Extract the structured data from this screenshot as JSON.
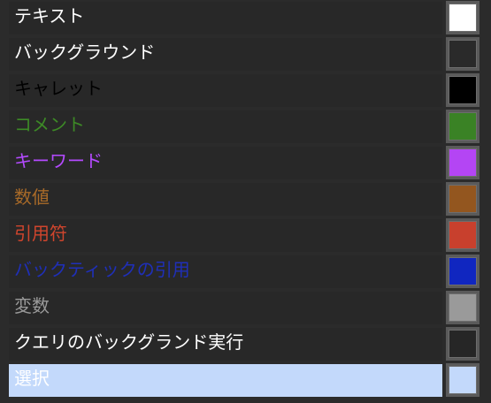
{
  "color_settings": [
    {
      "label": "テキスト",
      "text_color": "#ffffff",
      "swatch": "#ffffff"
    },
    {
      "label": "バックグラウンド",
      "text_color": "#ffffff",
      "swatch": "#2a2a2a"
    },
    {
      "label": "キャレット",
      "text_color": "#000000",
      "swatch": "#000000"
    },
    {
      "label": "コメント",
      "text_color": "#3d8a26",
      "swatch": "#3a8225"
    },
    {
      "label": "キーワード",
      "text_color": "#b44aff",
      "swatch": "#b445f4"
    },
    {
      "label": "数値",
      "text_color": "#a86a28",
      "swatch": "#93561f"
    },
    {
      "label": "引用符",
      "text_color": "#d0452d",
      "swatch": "#c8402d"
    },
    {
      "label": "バックティックの引用",
      "text_color": "#1f2fb8",
      "swatch": "#1026c0"
    },
    {
      "label": "変数",
      "text_color": "#9a9a9a",
      "swatch": "#9a9a9a"
    },
    {
      "label": "クエリのバックグランド実行",
      "text_color": "#ffffff",
      "swatch": "#262626"
    },
    {
      "label": "選択",
      "text_color": "#ffffff",
      "swatch": "#c3d9fb",
      "selected": true
    }
  ]
}
